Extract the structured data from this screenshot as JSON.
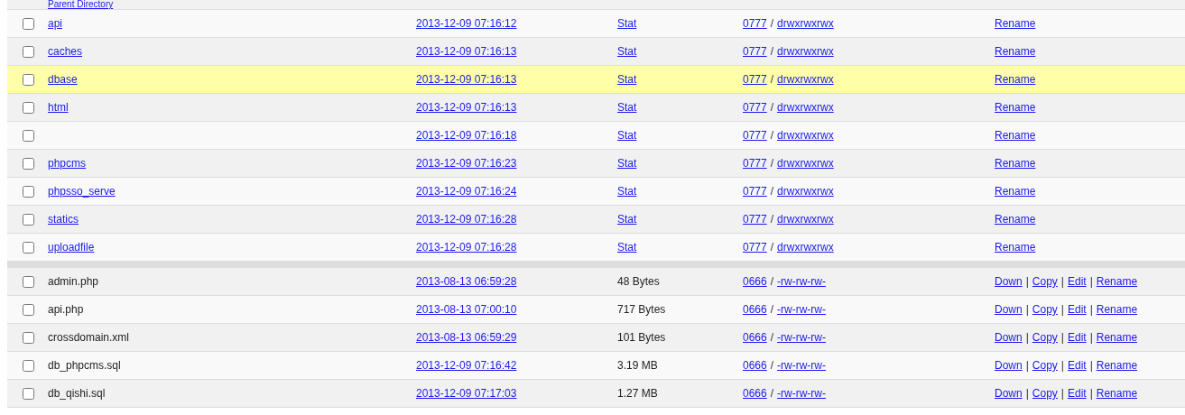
{
  "parent_row": {
    "label": "Parent Directory"
  },
  "directories": [
    {
      "name": "api",
      "modified": "2013-12-09 07:16:12",
      "info": "Stat",
      "octal": "0777",
      "perms": "drwxrwxrwx",
      "actions": [
        "Rename"
      ],
      "checked": false,
      "selected": false
    },
    {
      "name": "caches",
      "modified": "2013-12-09 07:16:13",
      "info": "Stat",
      "octal": "0777",
      "perms": "drwxrwxrwx",
      "actions": [
        "Rename"
      ],
      "checked": false,
      "selected": false
    },
    {
      "name": "dbase",
      "modified": "2013-12-09 07:16:13",
      "info": "Stat",
      "octal": "0777",
      "perms": "drwxrwxrwx",
      "actions": [
        "Rename"
      ],
      "checked": false,
      "selected": true
    },
    {
      "name": "html",
      "modified": "2013-12-09 07:16:13",
      "info": "Stat",
      "octal": "0777",
      "perms": "drwxrwxrwx",
      "actions": [
        "Rename"
      ],
      "checked": false,
      "selected": false
    },
    {
      "modified": "2013-12-09 07:16:18",
      "info": "Stat",
      "octal": "0777",
      "perms": "drwxrwxrwx",
      "actions": [
        "Rename"
      ],
      "checked": false,
      "selected": false
    },
    {
      "name": "phpcms",
      "modified": "2013-12-09 07:16:23",
      "info": "Stat",
      "octal": "0777",
      "perms": "drwxrwxrwx",
      "actions": [
        "Rename"
      ],
      "checked": false,
      "selected": false
    },
    {
      "name": "phpsso_serve",
      "modified": "2013-12-09 07:16:24",
      "info": "Stat",
      "octal": "0777",
      "perms": "drwxrwxrwx",
      "actions": [
        "Rename"
      ],
      "checked": false,
      "selected": false
    },
    {
      "name": "statics",
      "modified": "2013-12-09 07:16:28",
      "info": "Stat",
      "octal": "0777",
      "perms": "drwxrwxrwx",
      "actions": [
        "Rename"
      ],
      "checked": false,
      "selected": false
    },
    {
      "name": "uploadfile",
      "modified": "2013-12-09 07:16:28",
      "info": "Stat",
      "octal": "0777",
      "perms": "drwxrwxrwx",
      "actions": [
        "Rename"
      ],
      "checked": false,
      "selected": false
    }
  ],
  "files": [
    {
      "name": "admin.php",
      "modified": "2013-08-13 06:59:28",
      "info": "48 Bytes",
      "octal": "0666",
      "perms": "-rw-rw-rw-",
      "actions": [
        "Down",
        "Copy",
        "Edit",
        "Rename"
      ],
      "checked": false,
      "selected": false
    },
    {
      "name": "api.php",
      "modified": "2013-08-13 07:00:10",
      "info": "717 Bytes",
      "octal": "0666",
      "perms": "-rw-rw-rw-",
      "actions": [
        "Down",
        "Copy",
        "Edit",
        "Rename"
      ],
      "checked": false,
      "selected": false
    },
    {
      "name": "crossdomain.xml",
      "modified": "2013-08-13 06:59:29",
      "info": "101 Bytes",
      "octal": "0666",
      "perms": "-rw-rw-rw-",
      "actions": [
        "Down",
        "Copy",
        "Edit",
        "Rename"
      ],
      "checked": false,
      "selected": false
    },
    {
      "name": "db_phpcms.sql",
      "modified": "2013-12-09 07:16:42",
      "info": "3.19 MB",
      "octal": "0666",
      "perms": "-rw-rw-rw-",
      "actions": [
        "Down",
        "Copy",
        "Edit",
        "Rename"
      ],
      "checked": false,
      "selected": false
    },
    {
      "name": "db_qishi.sql",
      "modified": "2013-12-09 07:17:03",
      "info": "1.27 MB",
      "octal": "0666",
      "perms": "-rw-rw-rw-",
      "actions": [
        "Down",
        "Copy",
        "Edit",
        "Rename"
      ],
      "checked": false,
      "selected": false
    }
  ],
  "separators": {
    "perm": "/",
    "action": "|"
  }
}
